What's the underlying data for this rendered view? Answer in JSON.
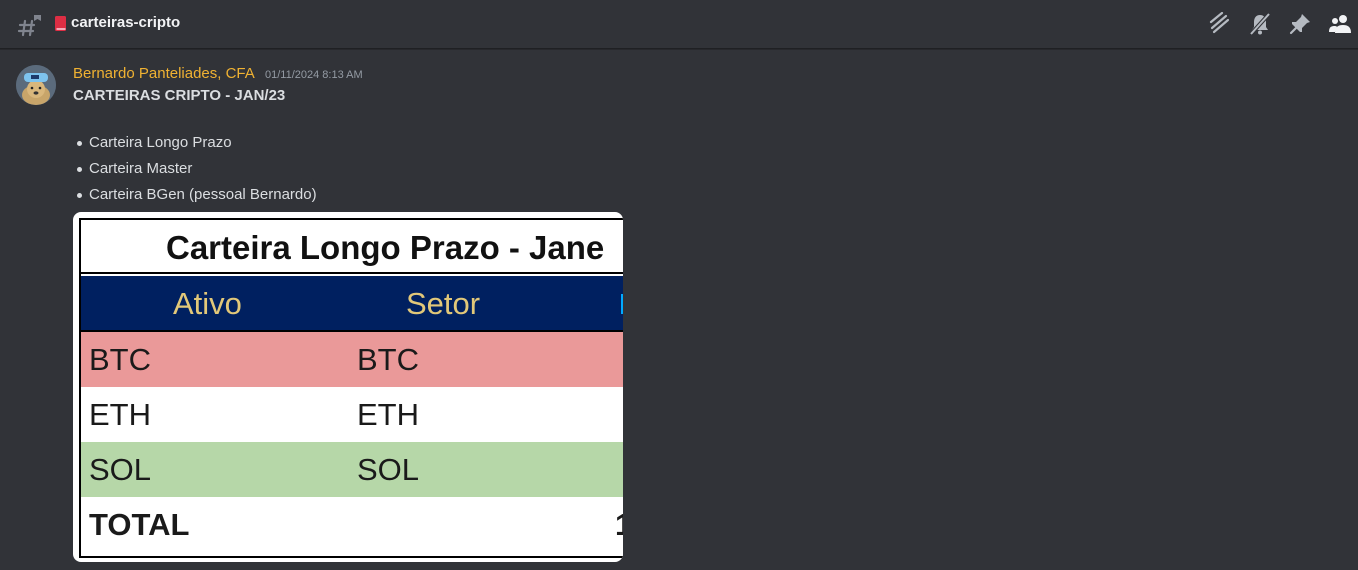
{
  "channel": {
    "name": "carteiras-cripto"
  },
  "toolbar": {
    "icons": [
      "threads-icon",
      "mute-bell-icon",
      "pin-icon",
      "members-icon"
    ]
  },
  "message": {
    "author": "Bernardo Panteliades, CFA",
    "timestamp": "01/11/2024 8:13 AM",
    "title": "CARTEIRAS CRIPTO - JAN/23",
    "bullets": [
      "Carteira Longo Prazo",
      "Carteira Master",
      "Carteira BGen (pessoal Bernardo)"
    ],
    "attachment": {
      "sheet_title": "Carteira Longo Prazo - Jane",
      "headers": [
        "Ativo",
        "Setor"
      ],
      "rows": [
        {
          "ativo": "BTC",
          "setor": "BTC",
          "extra": ""
        },
        {
          "ativo": "ETH",
          "setor": "ETH",
          "extra": ""
        },
        {
          "ativo": "SOL",
          "setor": "SOL",
          "extra": ""
        },
        {
          "ativo": "TOTAL",
          "setor": "",
          "extra": "1"
        }
      ],
      "row_colors": [
        "#ea9999",
        "#ffffff",
        "#b6d7a8",
        "#ffffff"
      ],
      "header_color": "#002060"
    }
  }
}
